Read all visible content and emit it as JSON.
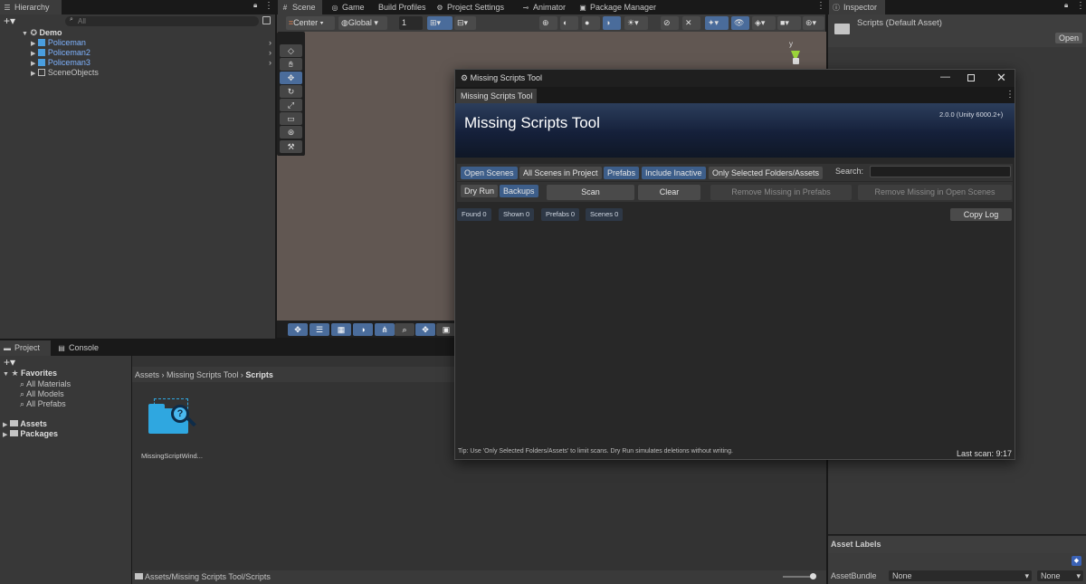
{
  "hierarchy": {
    "tab_label": "Hierarchy",
    "search_placeholder": "All",
    "root": "Demo",
    "items": [
      {
        "label": "Policeman"
      },
      {
        "label": "Policeman2"
      },
      {
        "label": "Policeman3"
      },
      {
        "label": "SceneObjects"
      }
    ]
  },
  "top_tabs": {
    "scene": "Scene",
    "game": "Game",
    "build_profiles": "Build Profiles",
    "project_settings": "Project Settings",
    "animator": "Animator",
    "package_manager": "Package Manager"
  },
  "scene_toolbar": {
    "pivot": "Center",
    "space": "Global",
    "grid_value": "1"
  },
  "gizmo": {
    "axis_label": "y"
  },
  "inspector": {
    "tab_label": "Inspector",
    "asset_title": "Scripts (Default Asset)",
    "open_button": "Open",
    "asset_labels": "Asset Labels",
    "asset_bundle_label": "AssetBundle",
    "asset_bundle_value": "None",
    "variant_value": "None"
  },
  "project": {
    "tab_project": "Project",
    "tab_console": "Console",
    "favorites_label": "Favorites",
    "favorites": [
      "All Materials",
      "All Models",
      "All Prefabs"
    ],
    "roots": [
      "Assets",
      "Packages"
    ],
    "breadcrumb": [
      "Assets",
      "Missing Scripts Tool",
      "Scripts"
    ],
    "file_name": "MissingScriptWind...",
    "footer_path": "Assets/Missing Scripts Tool/Scripts"
  },
  "tool_window": {
    "title": "Missing Scripts Tool",
    "tab": "Missing Scripts Tool",
    "header_title": "Missing Scripts Tool",
    "version": "2.0.0 (Unity 6000.2+)",
    "filters": [
      {
        "label": "Open Scenes",
        "on": true
      },
      {
        "label": "All Scenes in Project",
        "on": false
      },
      {
        "label": "Prefabs",
        "on": true
      },
      {
        "label": "Include Inactive",
        "on": true
      },
      {
        "label": "Only Selected Folders/Assets",
        "on": false
      }
    ],
    "search_label": "Search:",
    "search_value": "",
    "dry_run": "Dry Run",
    "backups": "Backups",
    "scan": "Scan",
    "clear": "Clear",
    "remove_prefabs": "Remove Missing in Prefabs",
    "remove_scenes": "Remove Missing in Open Scenes",
    "stats": [
      "Found 0",
      "Shown 0",
      "Prefabs 0",
      "Scenes 0"
    ],
    "copy_log": "Copy Log",
    "tip": "Tip: Use 'Only Selected Folders/Assets' to limit scans. Dry Run simulates deletions without writing.",
    "last_scan": "Last scan: 9:17"
  },
  "colors": {
    "accent": "#3d5e8a",
    "selected_blue": "#4a6c9b",
    "link_blue": "#7fb3ff",
    "header_top": "#2c3e5c",
    "header_bottom": "#0f1726"
  }
}
